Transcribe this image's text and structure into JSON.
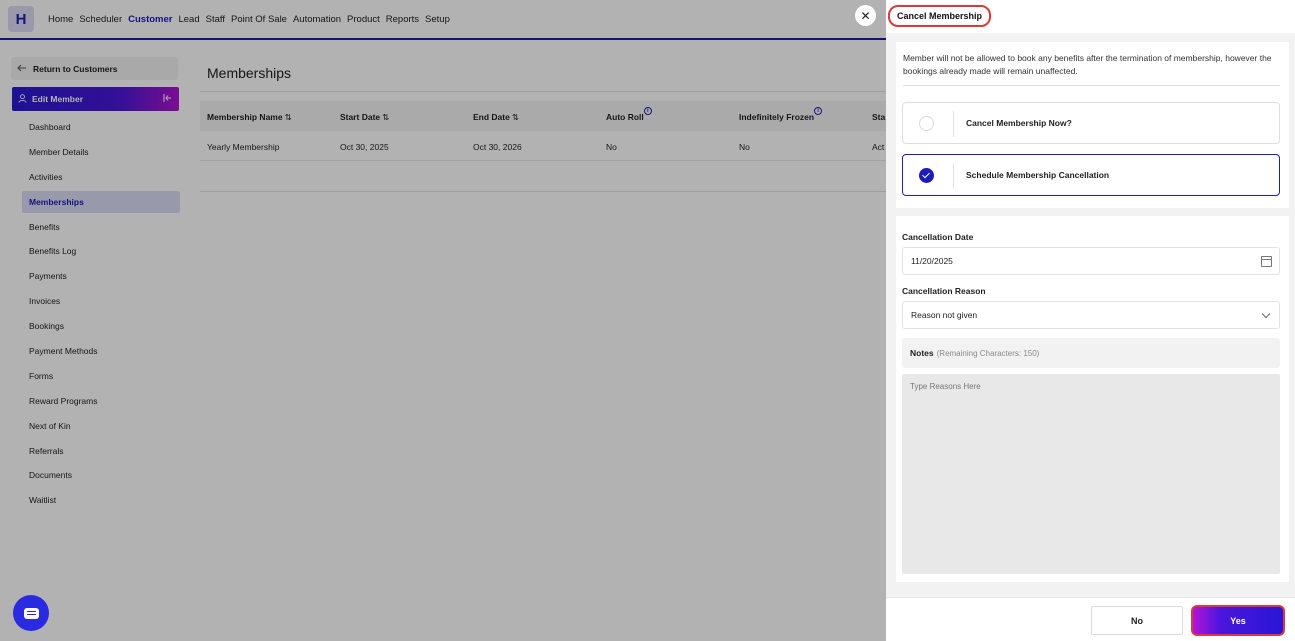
{
  "app": {
    "logo_letter": "H"
  },
  "nav": {
    "items": [
      "Home",
      "Scheduler",
      "Customer",
      "Lead",
      "Staff",
      "Point Of Sale",
      "Automation",
      "Product",
      "Reports",
      "Setup"
    ],
    "active": "Customer"
  },
  "sidebar": {
    "return_label": "Return to Customers",
    "edit_member_label": "Edit Member",
    "items": [
      "Dashboard",
      "Member Details",
      "Activities",
      "Memberships",
      "Benefits",
      "Benefits Log",
      "Payments",
      "Invoices",
      "Bookings",
      "Payment Methods",
      "Forms",
      "Reward Programs",
      "Next of Kin",
      "Referrals",
      "Documents",
      "Waitlist"
    ],
    "active": "Memberships"
  },
  "main": {
    "title": "Memberships",
    "columns": [
      "Membership Name",
      "Start Date",
      "End Date",
      "Auto Roll",
      "Indefinitely Frozen",
      "Sta"
    ],
    "rows": [
      {
        "name": "Yearly Membership",
        "start": "Oct 30, 2025",
        "end": "Oct 30, 2026",
        "auto_roll": "No",
        "frozen": "No",
        "status": "Act"
      }
    ]
  },
  "drawer": {
    "title": "Cancel Membership",
    "notice": "Member will not be allowed to book any benefits after the termination of membership, however the bookings already made will remain unaffected.",
    "options": [
      {
        "label": "Cancel Membership Now?",
        "selected": false
      },
      {
        "label": "Schedule Membership Cancellation",
        "selected": true
      }
    ],
    "cancellation_date_label": "Cancellation Date",
    "cancellation_date_value": "11/20/2025",
    "cancellation_reason_label": "Cancellation Reason",
    "cancellation_reason_value": "Reason not given",
    "notes_label": "Notes",
    "notes_remaining": "(Remaining Characters: 150)",
    "notes_placeholder": "Type Reasons Here",
    "no_label": "No",
    "yes_label": "Yes"
  },
  "colors": {
    "accent": "#1c1cb8",
    "highlight_outline": "#d83b3b",
    "dim_overlay": "rgba(0,0,0,0.30)"
  }
}
